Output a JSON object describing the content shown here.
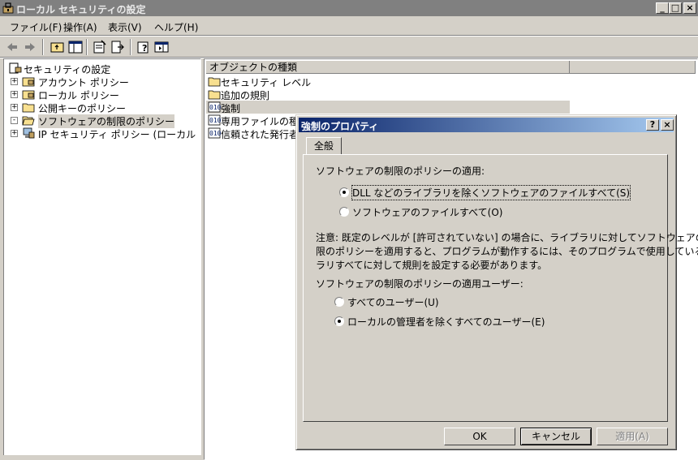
{
  "window": {
    "title": "ローカル セキュリティの設定",
    "minimize_glyph": "_",
    "maximize_glyph": "□",
    "close_glyph": "×"
  },
  "menu": [
    {
      "label": "ファイル(F)"
    },
    {
      "label": "操作(A)"
    },
    {
      "label": "表示(V)"
    },
    {
      "label": "ヘルプ(H)"
    }
  ],
  "toolbar": {
    "icons": [
      "back-arrow-icon",
      "forward-arrow-icon",
      "up-folder-icon",
      "show-hide-tree-icon",
      "properties-icon",
      "export-list-icon",
      "help-icon",
      "console-icon"
    ]
  },
  "tree": {
    "items": [
      {
        "label": "セキュリティの設定",
        "icon": "security-settings-icon",
        "level": 0,
        "expander": ""
      },
      {
        "label": "アカウント ポリシー",
        "icon": "folder-lock-icon",
        "level": 1,
        "expander": "+"
      },
      {
        "label": "ローカル ポリシー",
        "icon": "folder-lock-icon",
        "level": 1,
        "expander": "+"
      },
      {
        "label": "公開キーのポリシー",
        "icon": "folder-icon",
        "level": 1,
        "expander": "+"
      },
      {
        "label": "ソフトウェアの制限のポリシー",
        "icon": "folder-open-icon",
        "level": 1,
        "expander": "-",
        "selected": true
      },
      {
        "label": "IP セキュリティ ポリシー (ローカル コンピュー",
        "icon": "ip-security-icon",
        "level": 1,
        "expander": "+"
      }
    ]
  },
  "list": {
    "column_header": "オブジェクトの種類",
    "items": [
      {
        "label": "セキュリティ レベル",
        "icon": "folder-icon"
      },
      {
        "label": "追加の規則",
        "icon": "folder-icon"
      },
      {
        "label": "強制",
        "icon": "policy-setting-icon",
        "selected": true
      },
      {
        "label": "専用ファイルの種類",
        "icon": "policy-setting-icon"
      },
      {
        "label": "信頼された発行者",
        "icon": "policy-setting-icon"
      }
    ]
  },
  "dialog": {
    "title": "強制のプロパティ",
    "help_glyph": "?",
    "close_glyph": "×",
    "tab_label": "全般",
    "apply_section_label": "ソフトウェアの制限のポリシーの適用:",
    "apply_options": [
      {
        "label": "DLL などのライブラリを除くソフトウェアのファイルすべて(S)",
        "checked": true
      },
      {
        "label": "ソフトウェアのファイルすべて(O)",
        "checked": false
      }
    ],
    "note_lines": [
      "注意:  既定のレベルが [許可されていない] の場合に、ライブラリに対してソフトウェアの制",
      "限のポリシーを適用すると、プログラムが動作するには、そのプログラムで使用しているライブ",
      "ラリすべてに対して規則を設定する必要があります。"
    ],
    "users_section_label": "ソフトウェアの制限のポリシーの適用ユーザー:",
    "user_options": [
      {
        "label": "すべてのユーザー(U)",
        "checked": false
      },
      {
        "label": "ローカルの管理者を除くすべてのユーザー(E)",
        "checked": true
      }
    ],
    "ok_label": "OK",
    "cancel_label": "キャンセル",
    "apply_label": "適用(A)"
  }
}
